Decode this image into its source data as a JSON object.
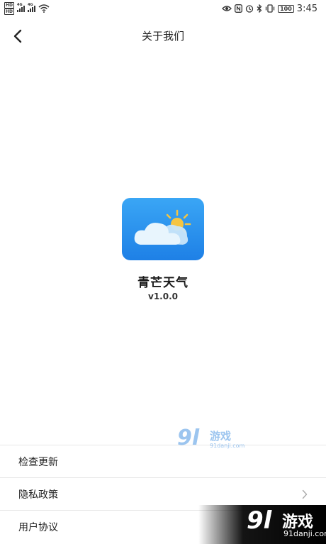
{
  "status_bar": {
    "hd1": "HD",
    "hd2": "HD",
    "net1": "4G",
    "net2": "4G",
    "battery": "100",
    "time": "3:45"
  },
  "nav": {
    "title": "关于我们"
  },
  "app": {
    "name": "青芒天气",
    "version": "v1.0.0"
  },
  "menu": {
    "items": [
      {
        "label": "检查更新"
      },
      {
        "label": "隐私政策"
      },
      {
        "label": "用户协议"
      }
    ]
  },
  "watermark": {
    "logo": "9l",
    "text": "游戏",
    "domain": "91danji.com"
  },
  "colors": {
    "icon_top": "#3aa6f5",
    "icon_bottom": "#1e80e6",
    "sun": "#f5c542",
    "divider": "#e6e6e6"
  }
}
